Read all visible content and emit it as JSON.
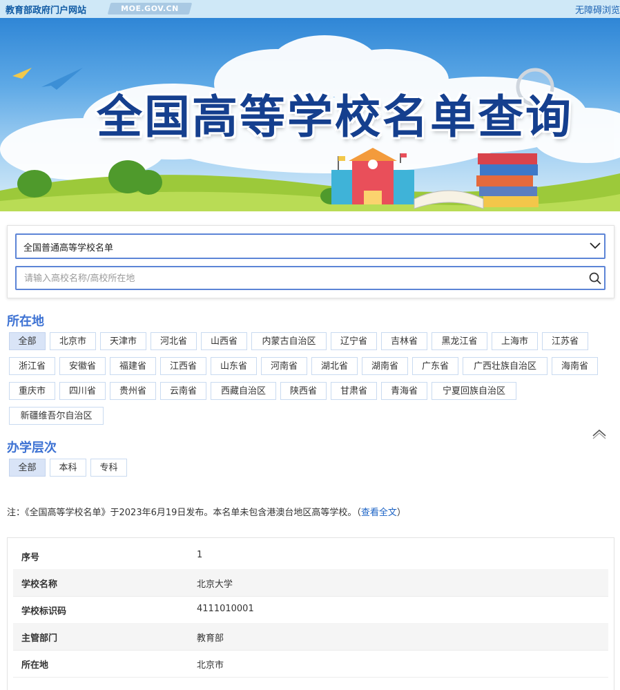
{
  "topbar": {
    "site_title": "教育部政府门户网站",
    "domain": "MOE.GOV.CN",
    "accessibility": "无障碍浏览"
  },
  "banner": {
    "title": "全国高等学校名单查询"
  },
  "search": {
    "list_select_value": "全国普通高等学校名单",
    "placeholder": "请输入高校名称/高校所在地"
  },
  "location": {
    "title": "所在地",
    "items": [
      "全部",
      "北京市",
      "天津市",
      "河北省",
      "山西省",
      "内蒙古自治区",
      "辽宁省",
      "吉林省",
      "黑龙江省",
      "上海市",
      "江苏省",
      "浙江省",
      "安徽省",
      "福建省",
      "江西省",
      "山东省",
      "河南省",
      "湖北省",
      "湖南省",
      "广东省",
      "广西壮族自治区",
      "海南省",
      "重庆市",
      "四川省",
      "贵州省",
      "云南省",
      "西藏自治区",
      "陕西省",
      "甘肃省",
      "青海省",
      "宁夏回族自治区",
      "新疆维吾尔自治区"
    ],
    "selected": "全部"
  },
  "level": {
    "title": "办学层次",
    "items": [
      "全部",
      "本科",
      "专科"
    ],
    "selected": "全部"
  },
  "note": {
    "text": "注：《全国高等学校名单》于2023年6月19日发布。本名单未包含港澳台地区高等学校。（",
    "link": "查看全文",
    "suffix": "）"
  },
  "result": {
    "rows": [
      {
        "label": "序号",
        "value": "1"
      },
      {
        "label": "学校名称",
        "value": "北京大学"
      },
      {
        "label": "学校标识码",
        "value": "4111010001"
      },
      {
        "label": "主管部门",
        "value": "教育部"
      },
      {
        "label": "所在地",
        "value": "北京市"
      }
    ]
  },
  "colors": {
    "accent": "#3d72d3",
    "border_blue": "#5c84d6",
    "chip_active": "#d9e4f7",
    "link": "#1a62c5",
    "title_navy": "#153f8e"
  },
  "icons": {
    "dropdown": "chevron-down-icon",
    "search": "search-icon",
    "collapse": "chevron-up-icon"
  }
}
